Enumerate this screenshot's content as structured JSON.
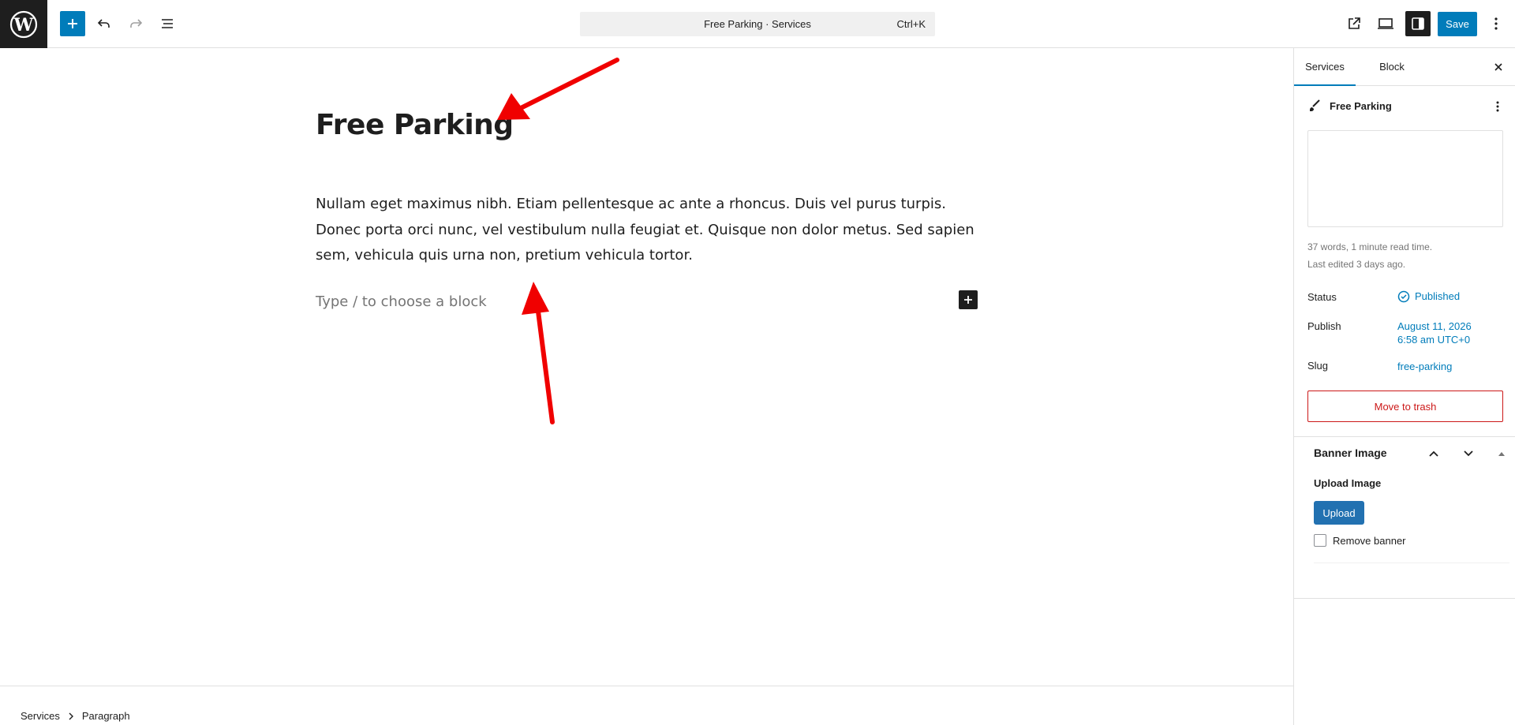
{
  "header": {
    "command_title": "Free Parking · Services",
    "command_shortcut": "Ctrl+K",
    "save_label": "Save"
  },
  "editor": {
    "title": "Free Parking",
    "paragraph": "Nullam eget maximus nibh. Etiam pellentesque ac ante a rhoncus. Duis vel purus turpis. Donec porta orci nunc, vel vestibulum nulla feugiat et. Quisque non dolor metus. Sed sapien sem, vehicula quis urna non, pretium vehicula tortor.",
    "placeholder": "Type / to choose a block"
  },
  "footer": {
    "breadcrumbs": [
      "Services",
      "Paragraph"
    ]
  },
  "sidebar": {
    "tabs": [
      {
        "label": "Services",
        "active": true
      },
      {
        "label": "Block",
        "active": false
      }
    ],
    "post_title": "Free Parking",
    "meta_words": "37 words, 1 minute read time.",
    "meta_edited": "Last edited 3 days ago.",
    "status_label": "Status",
    "status_value": "Published",
    "publish_label": "Publish",
    "publish_date": "August 11, 2026",
    "publish_time": "6:58 am UTC+0",
    "slug_label": "Slug",
    "slug_value": "free-parking",
    "trash_label": "Move to trash",
    "metabox": {
      "title": "Banner Image",
      "upload_label": "Upload Image",
      "upload_button": "Upload",
      "remove_label": "Remove banner"
    }
  },
  "colors": {
    "accent": "#007cba",
    "danger": "#cc1818",
    "dark": "#1e1e1e",
    "annotation_arrow": "#f00000"
  }
}
